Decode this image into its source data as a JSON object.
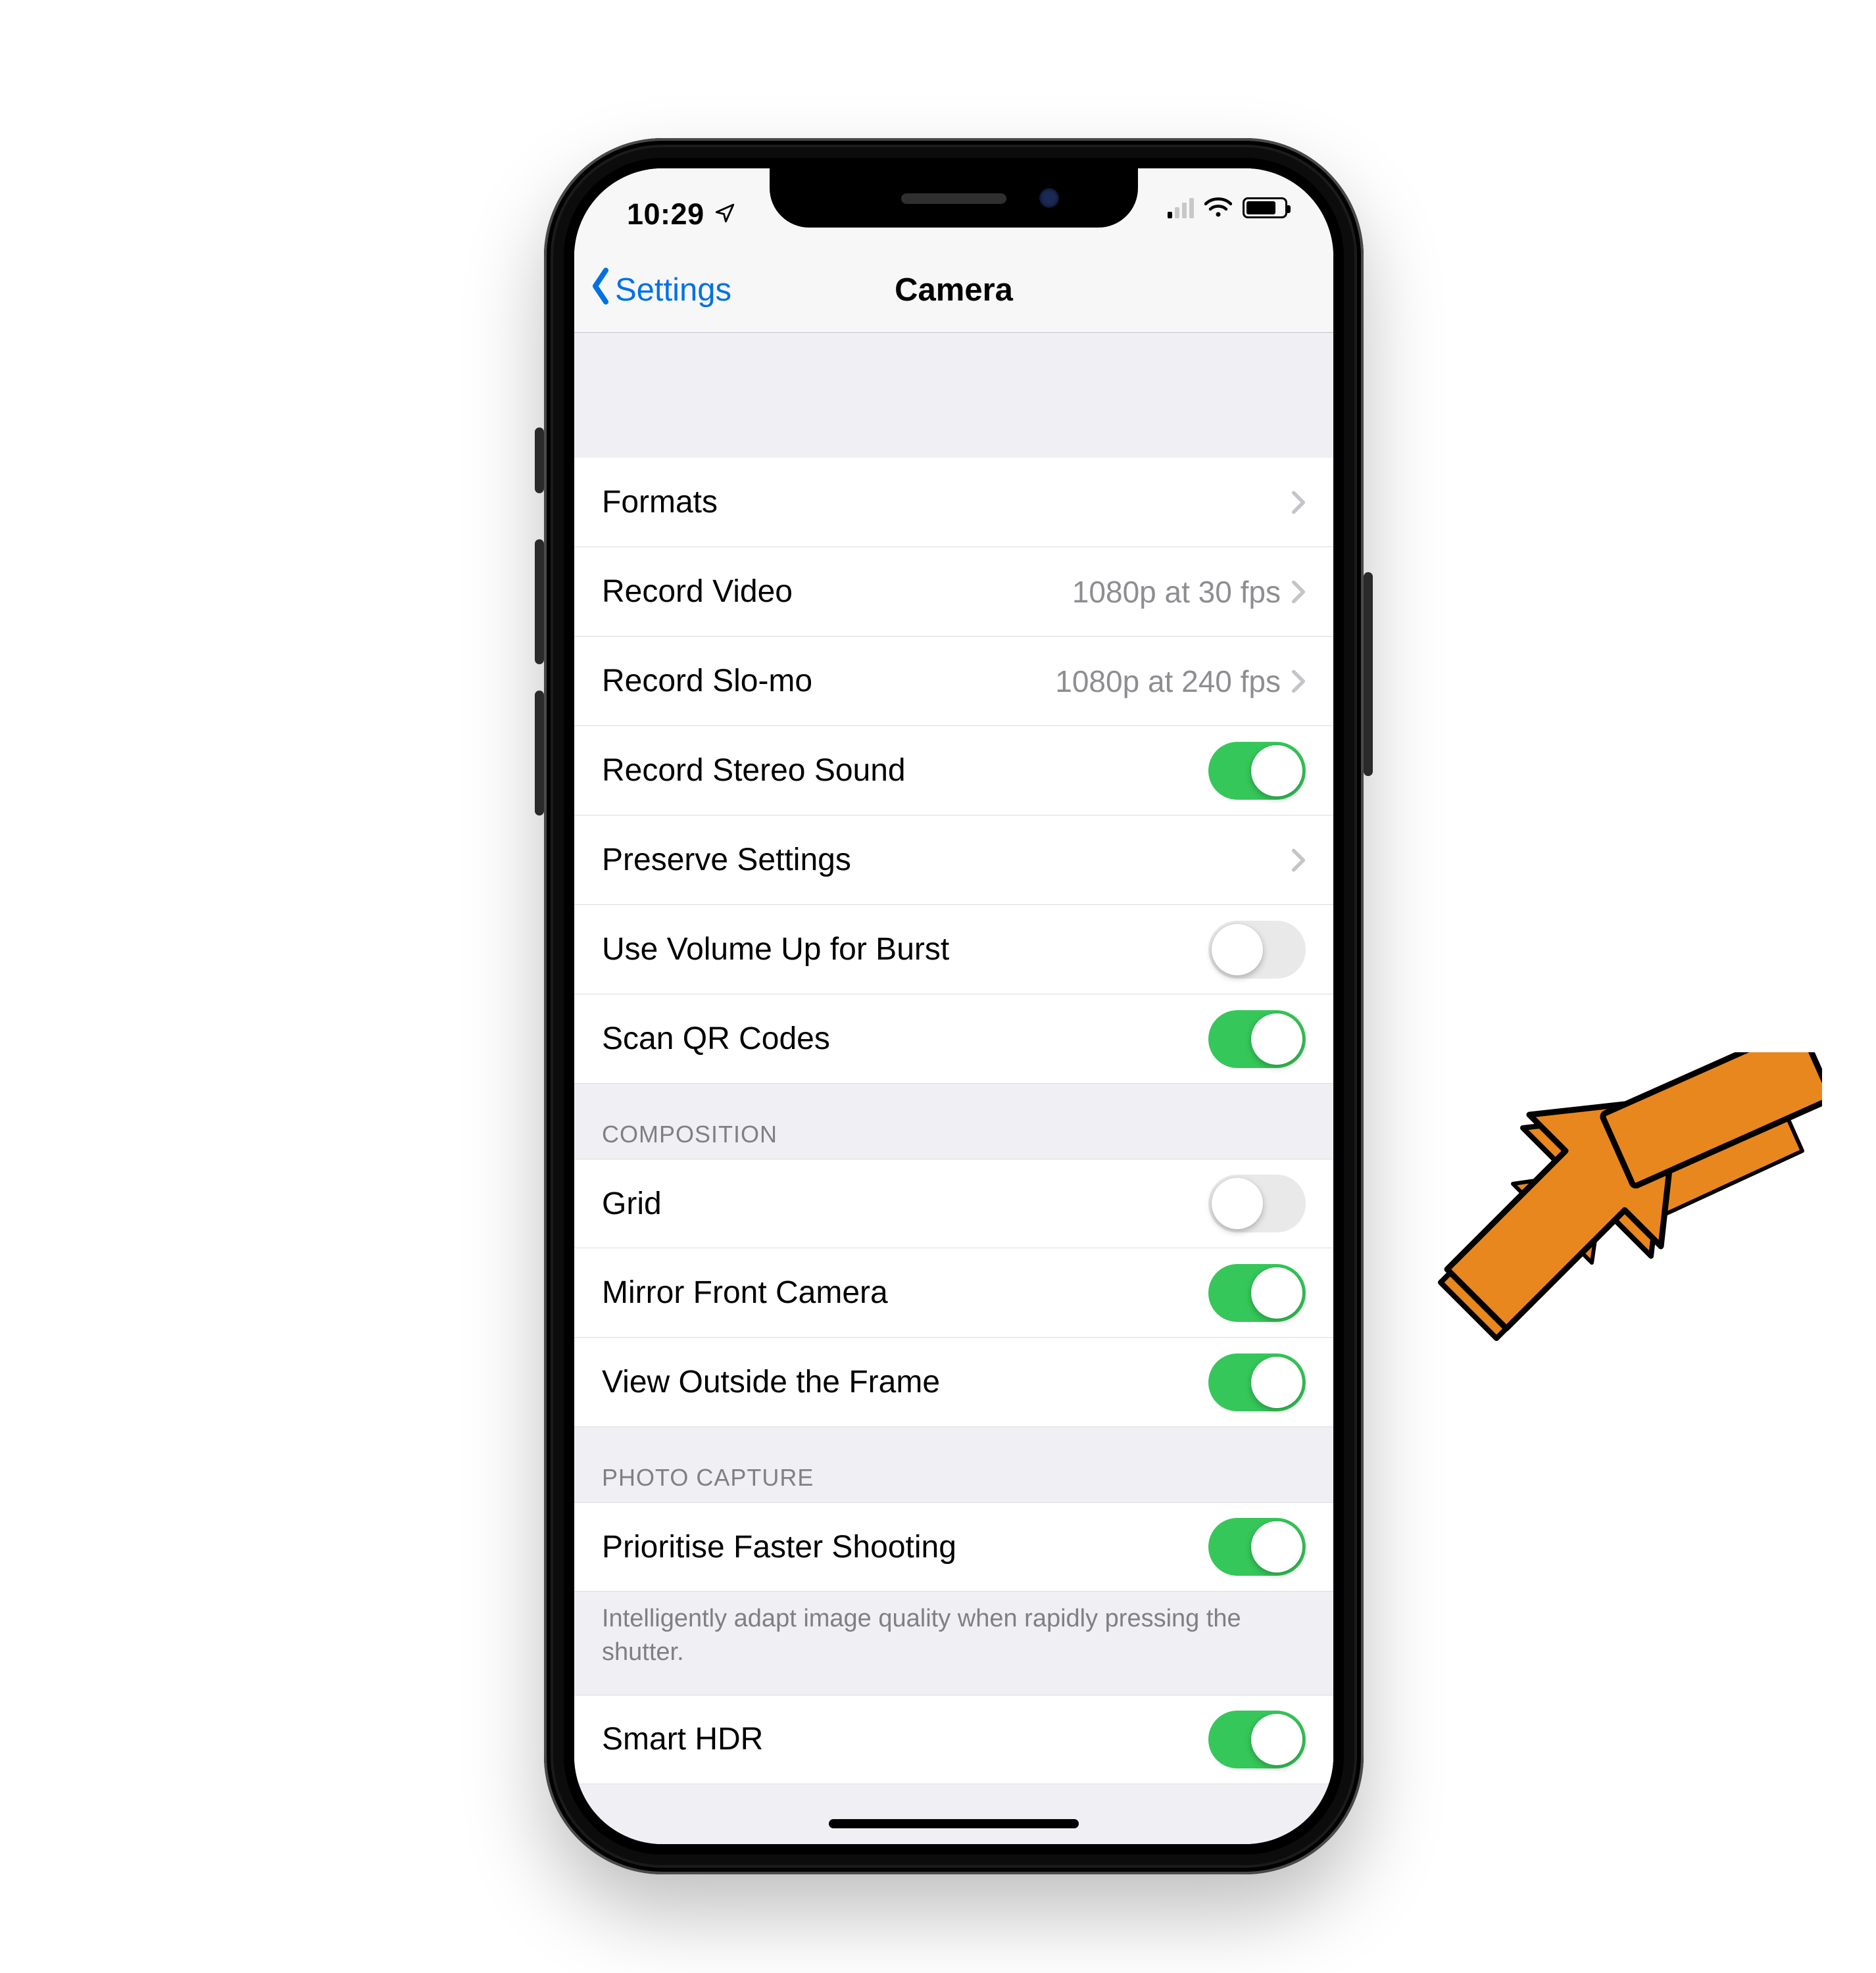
{
  "status": {
    "time": "10:29",
    "location_icon": "location-arrow-icon",
    "battery_level_percent": 72
  },
  "nav": {
    "back_label": "Settings",
    "title": "Camera"
  },
  "sections": [
    {
      "header": null,
      "rows": [
        {
          "kind": "link",
          "label": "Formats",
          "value": null
        },
        {
          "kind": "link",
          "label": "Record Video",
          "value": "1080p at 30 fps"
        },
        {
          "kind": "link",
          "label": "Record Slo-mo",
          "value": "1080p at 240 fps"
        },
        {
          "kind": "toggle",
          "label": "Record Stereo Sound",
          "on": true
        },
        {
          "kind": "link",
          "label": "Preserve Settings",
          "value": null
        },
        {
          "kind": "toggle",
          "label": "Use Volume Up for Burst",
          "on": false
        },
        {
          "kind": "toggle",
          "label": "Scan QR Codes",
          "on": true
        }
      ],
      "footer": null
    },
    {
      "header": "COMPOSITION",
      "rows": [
        {
          "kind": "toggle",
          "label": "Grid",
          "on": false
        },
        {
          "kind": "toggle",
          "label": "Mirror Front Camera",
          "on": true
        },
        {
          "kind": "toggle",
          "label": "View Outside the Frame",
          "on": true
        }
      ],
      "footer": null
    },
    {
      "header": "PHOTO CAPTURE",
      "rows": [
        {
          "kind": "toggle",
          "label": "Prioritise Faster Shooting",
          "on": true
        }
      ],
      "footer": "Intelligently adapt image quality when rapidly pressing the shutter."
    },
    {
      "header": null,
      "rows": [
        {
          "kind": "toggle",
          "label": "Smart HDR",
          "on": true
        }
      ],
      "footer": null
    }
  ]
}
